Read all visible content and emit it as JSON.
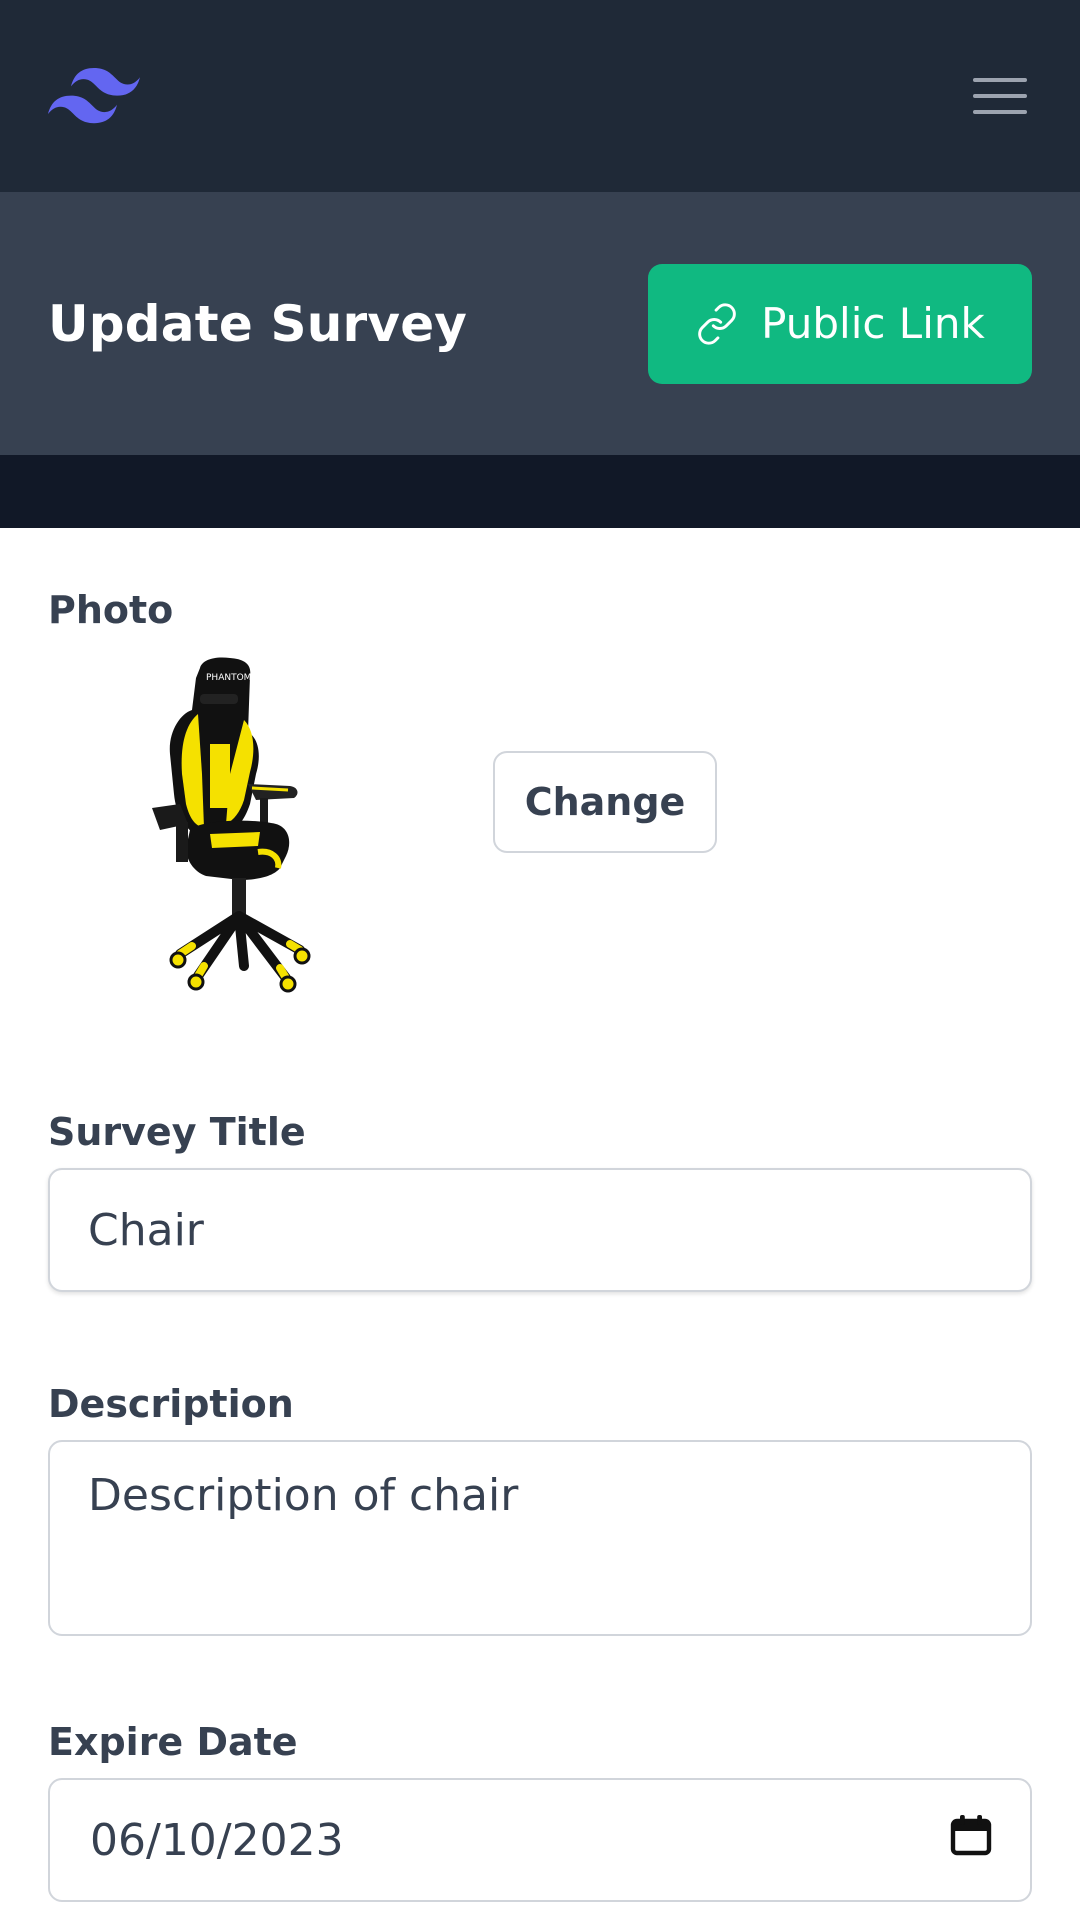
{
  "nav": {
    "logo_icon": "tailwind-logo-icon",
    "menu_icon": "hamburger-menu-icon"
  },
  "header": {
    "title": "Update Survey",
    "public_link_label": "Public Link",
    "public_link_icon": "link-icon"
  },
  "form": {
    "photo": {
      "label": "Photo",
      "change_label": "Change",
      "image_icon": "gaming-chair-image"
    },
    "survey_title": {
      "label": "Survey Title",
      "value": "Chair"
    },
    "description": {
      "label": "Description",
      "value": "Description of chair"
    },
    "expire_date": {
      "label": "Expire Date",
      "value": "06/10/2023",
      "icon": "calendar-icon"
    }
  },
  "colors": {
    "topbar": "#1f2937",
    "header": "#374151",
    "strip": "#111827",
    "accent_green": "#10b981",
    "logo_indigo": "#6366f1"
  }
}
